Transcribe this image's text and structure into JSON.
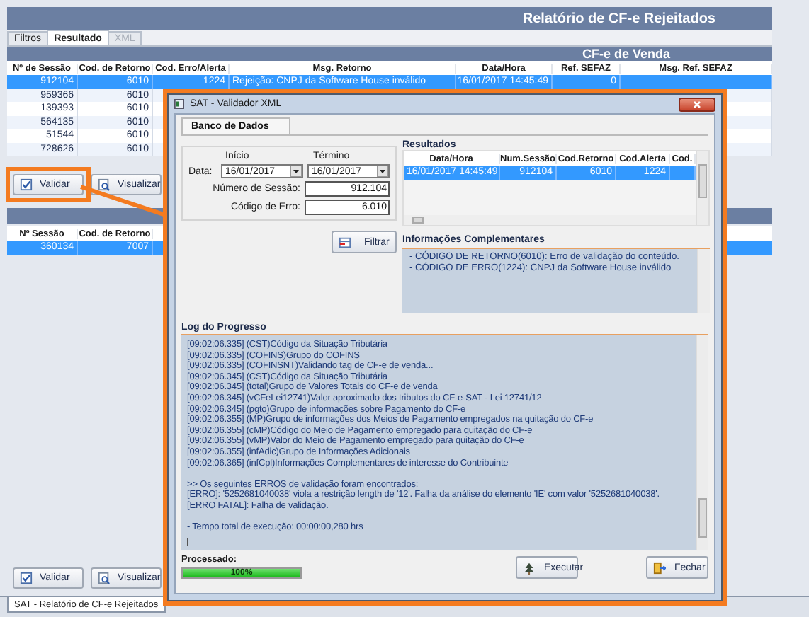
{
  "window": {
    "title": "Relatório de CF-e Rejeitados"
  },
  "tabs": [
    {
      "label": "Filtros",
      "selected": false,
      "disabled": false
    },
    {
      "label": "Resultado",
      "selected": true,
      "disabled": false
    },
    {
      "label": "XML",
      "selected": false,
      "disabled": true
    }
  ],
  "sales_table": {
    "title": "CF-e de Venda",
    "columns": [
      "Nº de Sessão",
      "Cod. de Retorno",
      "Cod. Erro/Alerta",
      "Msg. Retorno",
      "Data/Hora",
      "Ref. SEFAZ",
      "Msg. Ref. SEFAZ"
    ],
    "rows": [
      {
        "cells": [
          "912104",
          "6010",
          "1224",
          "Rejeição: CNPJ da Software House inválido",
          "16/01/2017 14:45:49",
          "0"
        ],
        "selected": true
      },
      {
        "cells": [
          "959366",
          "6010"
        ],
        "selected": false
      },
      {
        "cells": [
          "139393",
          "6010"
        ],
        "selected": false
      },
      {
        "cells": [
          "564135",
          "6010"
        ],
        "selected": false
      },
      {
        "cells": [
          "51544",
          "6010"
        ],
        "selected": false
      },
      {
        "cells": [
          "728626",
          "6010"
        ],
        "selected": false
      }
    ]
  },
  "actions": [
    {
      "label": "Validar",
      "kind": "validate",
      "highlighted": true
    },
    {
      "label": "Visualizar",
      "kind": "view",
      "highlighted": false
    }
  ],
  "second_table": {
    "columns": [
      "Nº Sessão",
      "Cod. de Retorno"
    ],
    "rows": [
      {
        "cells": [
          "360134",
          "7007"
        ],
        "selected": true
      }
    ]
  },
  "bottom_actions": [
    {
      "label": "Validar",
      "kind": "validate"
    },
    {
      "label": "Visualizar",
      "kind": "view"
    }
  ],
  "document_tab": {
    "label": "SAT - Relatório de CF-e Rejeitados"
  },
  "dialog": {
    "title": "SAT - Validador XML",
    "tab": "Banco de Dados",
    "start_label": "Início",
    "end_label": "Término",
    "date_label": "Data:",
    "start_date": "16/01/2017",
    "end_date": "16/01/2017",
    "session_label": "Número de Sessão:",
    "session_value": "912.104",
    "error_label": "Código de Erro:",
    "error_value": "6.010",
    "filter_button": "Filtrar",
    "results": {
      "title": "Resultados",
      "columns": [
        "Data/Hora",
        "Num.Sessão",
        "Cod.Retorno",
        "Cod.Alerta",
        "Cod."
      ],
      "rows": [
        {
          "cells": [
            "16/01/2017 14:45:49",
            "912104",
            "6010",
            "1224"
          ],
          "selected": true
        }
      ]
    },
    "info": {
      "title": "Informações Complementares",
      "lines": [
        "- CÓDIGO DE RETORNO(6010): Erro de validação do conteúdo.",
        "- CÓDIGO DE ERRO(1224): CNPJ da Software House inválido"
      ]
    },
    "log": {
      "title": "Log do Progresso",
      "groups": [
        [
          "[09:02:06.335] (CST)Código da Situação Tributária",
          "[09:02:06.335] (COFINS)Grupo do COFINS",
          "[09:02:06.335] (COFINSNT)Validando tag de CF-e de venda...",
          "[09:02:06.345] (CST)Código da Situação Tributária",
          "[09:02:06.345] (total)Grupo de Valores Totais do CF-e de venda",
          "[09:02:06.345] (vCFeLei12741)Valor aproximado dos tributos do CF-e-SAT - Lei 12741/12",
          "[09:02:06.345] (pgto)Grupo de informações sobre Pagamento do CF-e",
          "[09:02:06.355] (MP)Grupo de informações dos Meios de Pagamento empregados na quitação do CF-e",
          "[09:02:06.355] (cMP)Código do Meio de Pagamento empregado para quitação do CF-e",
          "[09:02:06.355] (vMP)Valor do Meio de Pagamento empregado para quitação do CF-e",
          "[09:02:06.355] (infAdic)Grupo de Informações Adicionais",
          "[09:02:06.365] (infCpl)Informações Complementares de interesse do Contribuinte"
        ],
        [
          ">> Os seguintes ERROS de validação foram encontrados:",
          "[ERRO]: '5252681040038' viola a restrição length de '12'. Falha da análise do elemento 'IE' com valor '5252681040038'.",
          "[ERRO FATAL]: Falha de validação."
        ],
        [
          "- Tempo total de execução: 00:00:00,280 hrs"
        ]
      ]
    },
    "progress": {
      "label": "Processado:",
      "level": 1,
      "reading": "100%"
    },
    "buttons": [
      {
        "label": "Executar",
        "kind": "run"
      },
      {
        "label": "Fechar",
        "kind": "close"
      }
    ]
  }
}
